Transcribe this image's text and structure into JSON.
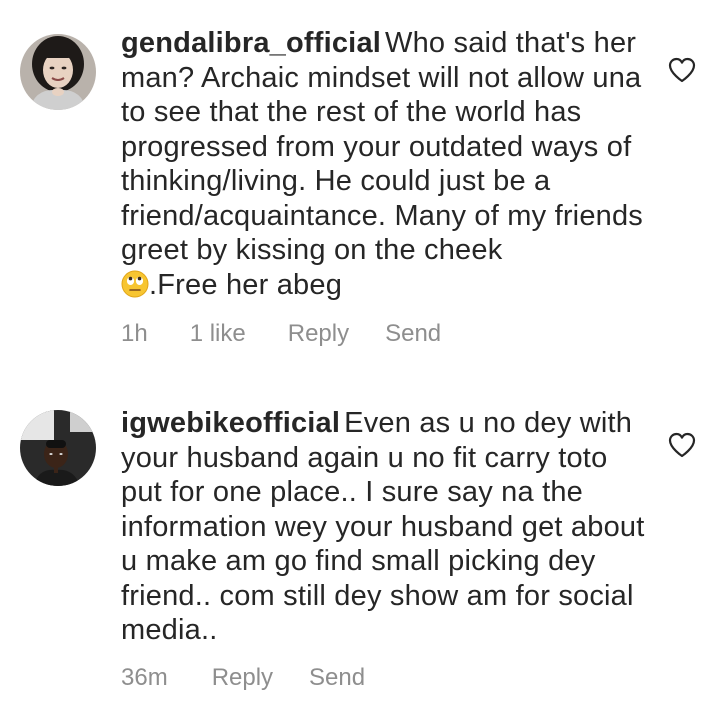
{
  "comments": [
    {
      "username": "gendalibra_official",
      "text": "Who said that's her man? Archaic mindset will not allow una to see that the rest of the world has progressed from your outdated ways of thinking/living. He could just be a friend/acquaintance. Many of my friends greet by kissing on the cheek",
      "emoji": "face-with-rolling-eyes",
      "text_after_emoji": ".Free her abeg",
      "time": "1h",
      "likes": "1 like",
      "reply_label": "Reply",
      "send_label": "Send",
      "like_icon": "heart-outline-icon"
    },
    {
      "username": "igwebikeofficial",
      "text": "Even as u no dey with your husband again u no fit carry toto put for one place.. I sure say na the information wey your husband get about u make am go find small picking dey friend.. com still dey show am for social media..",
      "time": "36m",
      "reply_label": "Reply",
      "send_label": "Send",
      "like_icon": "heart-outline-icon"
    }
  ],
  "colors": {
    "text": "#262626",
    "meta": "#8e8e8e",
    "background": "#ffffff"
  }
}
